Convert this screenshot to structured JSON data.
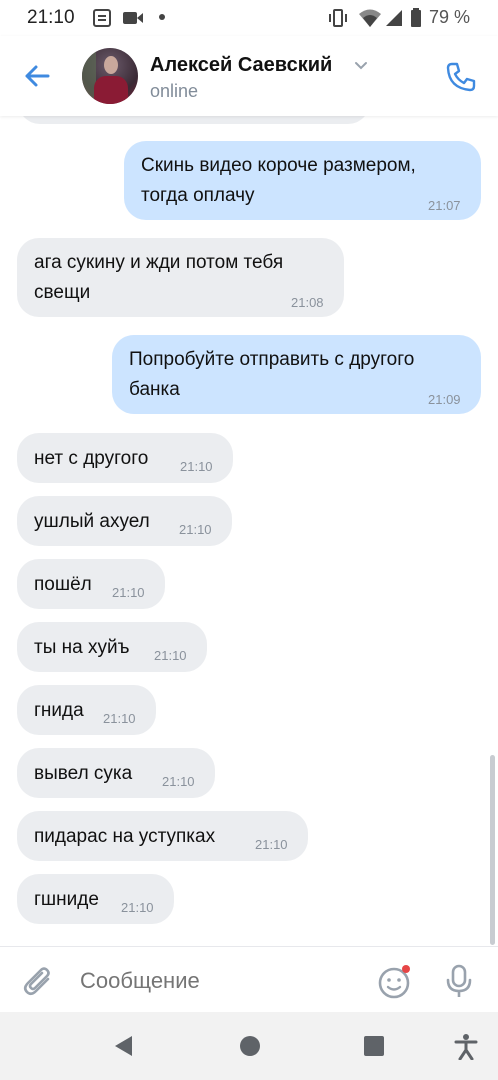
{
  "status_bar": {
    "time": "21:10",
    "battery": "79 %",
    "icons": [
      "notes-icon",
      "video-icon",
      "dot-icon",
      "vibrate-icon",
      "wifi-icon",
      "signal-icon",
      "battery-icon"
    ]
  },
  "header": {
    "contact_name": "Алексей Саевский",
    "status": "online",
    "back_icon": "arrow-left-icon",
    "call_icon": "phone-icon"
  },
  "messages": [
    {
      "dir": "out",
      "text": [
        "Скинь видео короче размером,",
        "тогда оплачу"
      ],
      "time": "21:07"
    },
    {
      "dir": "in",
      "text": [
        "ага сукину и жди потом тебя",
        "свещи"
      ],
      "time": "21:08"
    },
    {
      "dir": "out",
      "text": [
        "Попробуйте отправить с другого",
        "банка"
      ],
      "time": "21:09"
    },
    {
      "dir": "in",
      "text": [
        "нет с другого"
      ],
      "time": "21:10"
    },
    {
      "dir": "in",
      "text": [
        "ушлый ахуел"
      ],
      "time": "21:10"
    },
    {
      "dir": "in",
      "text": [
        "пошёл"
      ],
      "time": "21:10"
    },
    {
      "dir": "in",
      "text": [
        "ты на хуйъ"
      ],
      "time": "21:10"
    },
    {
      "dir": "in",
      "text": [
        "гнида"
      ],
      "time": "21:10"
    },
    {
      "dir": "in",
      "text": [
        "вывел сука"
      ],
      "time": "21:10"
    },
    {
      "dir": "in",
      "text": [
        "пидарас на уступках"
      ],
      "time": "21:10"
    },
    {
      "dir": "in",
      "text": [
        "гшниде"
      ],
      "time": "21:10"
    }
  ],
  "composer": {
    "placeholder": "Сообщение",
    "attach_icon": "paperclip-icon",
    "emoji_icon": "smile-icon",
    "mic_icon": "microphone-icon"
  },
  "colors": {
    "accent": "#2a5885",
    "blue_icon": "#3f8ae0",
    "incoming_bubble": "#ebedf0",
    "outgoing_bubble": "#cce4ff",
    "secondary_text": "#818c99"
  },
  "nav_bar": [
    "back-triangle-icon",
    "home-circle-icon",
    "recents-square-icon",
    "accessibility-icon"
  ]
}
